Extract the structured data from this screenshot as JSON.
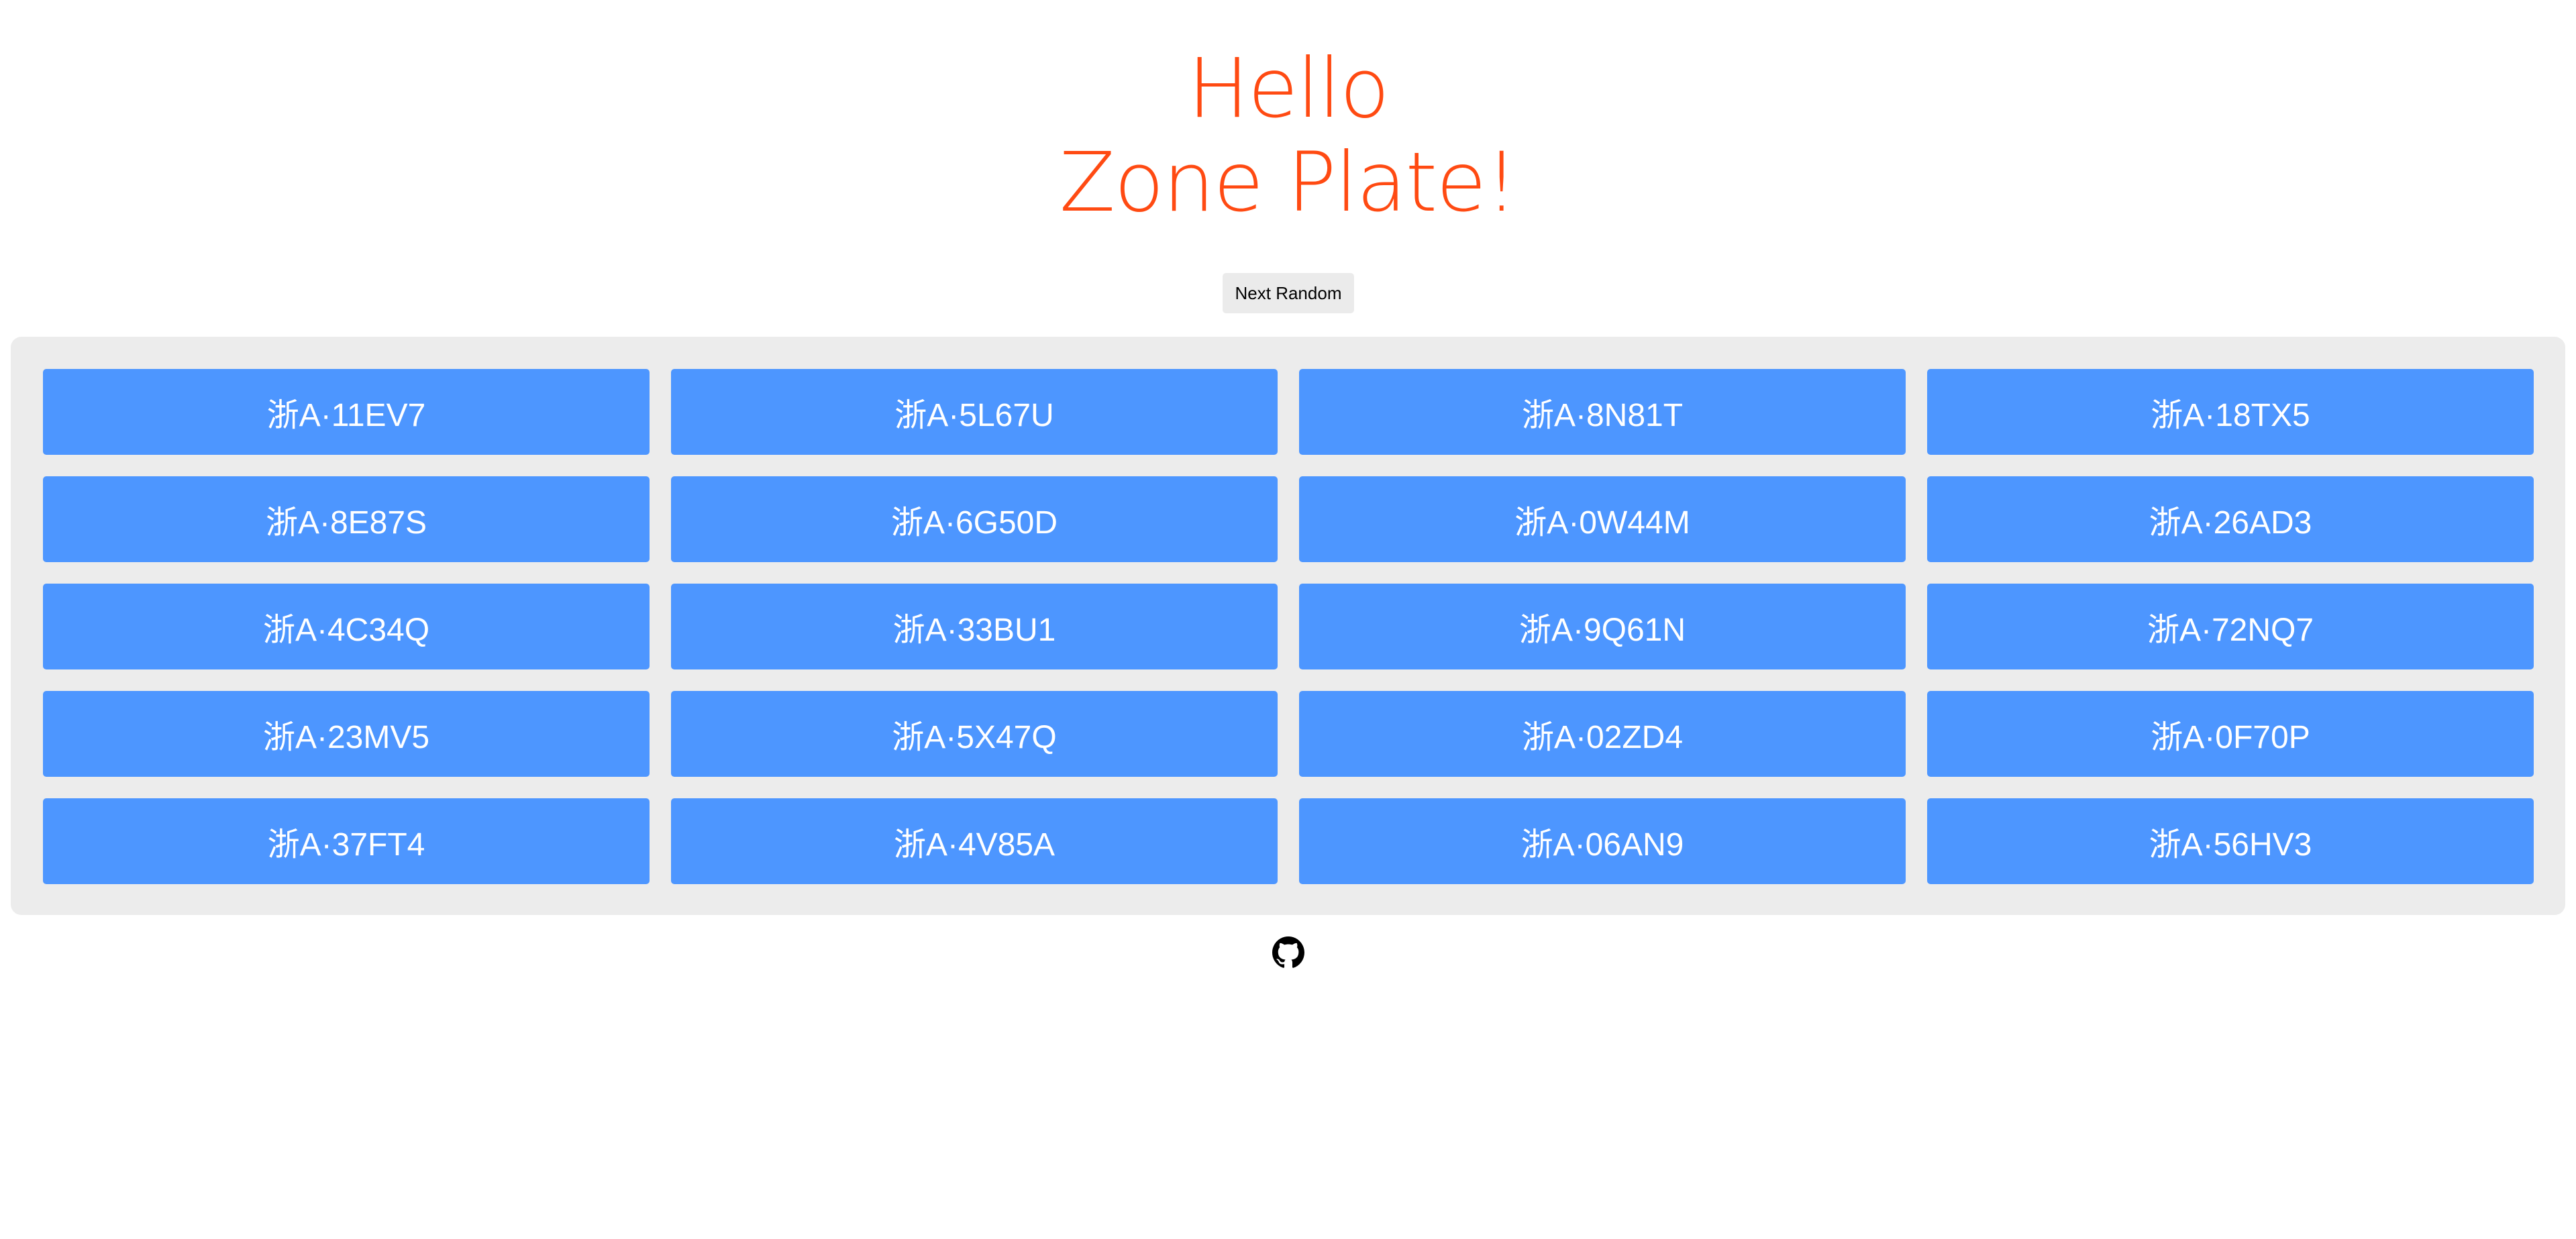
{
  "title": {
    "line1": "Hello",
    "line2": "Zone Plate!",
    "color": "#ff4a12"
  },
  "next_button": {
    "label": "Next Random"
  },
  "plates": [
    "浙A·11EV7",
    "浙A·5L67U",
    "浙A·8N81T",
    "浙A·18TX5",
    "浙A·8E87S",
    "浙A·6G50D",
    "浙A·0W44M",
    "浙A·26AD3",
    "浙A·4C34Q",
    "浙A·33BU1",
    "浙A·9Q61N",
    "浙A·72NQ7",
    "浙A·23MV5",
    "浙A·5X47Q",
    "浙A·02ZD4",
    "浙A·0F70P",
    "浙A·37FT4",
    "浙A·4V85A",
    "浙A·06AN9",
    "浙A·56HV3"
  ],
  "colors": {
    "plate_background": "#4d96ff",
    "panel_background": "#ececec",
    "button_background": "#ebebeb"
  },
  "footer": {
    "icon": "github-icon"
  }
}
